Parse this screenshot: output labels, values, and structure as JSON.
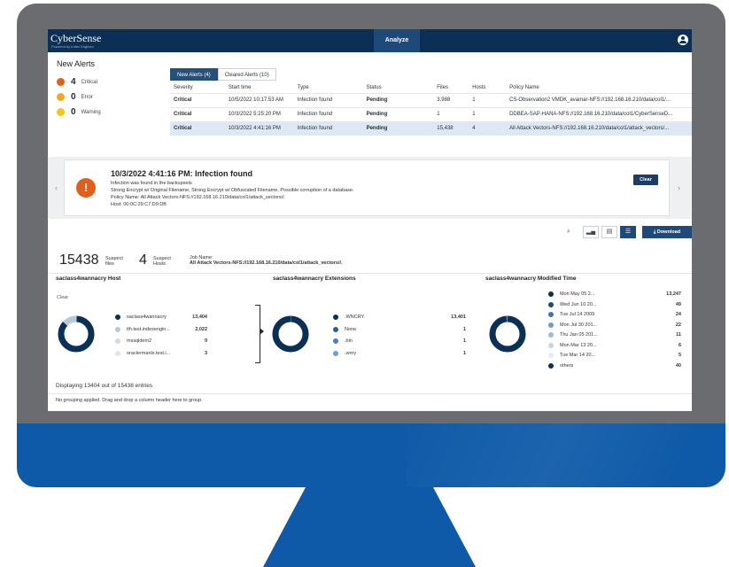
{
  "app": {
    "brand": "CyberSense",
    "brand_sub": "Powered by Index Engines",
    "nav_tab": "Analyze"
  },
  "new_alerts": {
    "title": "New Alerts",
    "items": [
      {
        "count": "4",
        "label": "Critical",
        "color": "#e05f1c"
      },
      {
        "count": "0",
        "label": "Error",
        "color": "#f0a824"
      },
      {
        "count": "0",
        "label": "Warning",
        "color": "#f5c518"
      }
    ]
  },
  "tabs": [
    {
      "label": "New Alerts (4)",
      "active": true
    },
    {
      "label": "Cleared Alerts (10)",
      "active": false
    }
  ],
  "alert_table": {
    "columns": [
      "Severity",
      "Start time",
      "Type",
      "Status",
      "Files",
      "Hosts",
      "Policy Name"
    ],
    "rows": [
      [
        "Critical",
        "10/5/2022 10:17:53 AM",
        "Infection found",
        "Pending",
        "3,988",
        "1",
        "CS-Observation2 VMDK_avamar-NFS://192.168.16.210/data/col1/..."
      ],
      [
        "Critical",
        "10/3/2022 5:25:20 PM",
        "Infection found",
        "Pending",
        "1",
        "1",
        "DDBEA-SAP-HANA-NFS://192.168.16.210/data/col1/CyberSenseD..."
      ],
      [
        "Critical",
        "10/3/2022 4:41:16 PM",
        "Infection found",
        "Pending",
        "15,438",
        "4",
        "All Attack Vectors-NFS://192.168.16.210/data/col1/attack_vectors/..."
      ]
    ]
  },
  "detail": {
    "title": "10/3/2022 4:41:16 PM: Infection found",
    "line1": "Infection was found in the backupsets",
    "line2": "Strong Encrypt w/ Original Filename, Strong Encrypt w/ Obfuscated Filename, Possible corruption of a database.",
    "line3": "Policy Name: All Attack Vectors-NFS://192.168.16.210/data/col1/attack_vectors//.",
    "line4": "Host: 00:0C:29:C7:D9:DB",
    "clear_label": "Clear"
  },
  "toolbar": {
    "download_label": "Download"
  },
  "stats": {
    "files_count": "15438",
    "files_label_1": "Suspect",
    "files_label_2": "files",
    "hosts_count": "4",
    "hosts_label_1": "Suspect",
    "hosts_label_2": "Hosts",
    "job_label": "Job Name:",
    "job_value": "All Attack Vectors-NFS://192.168.16.210/data/col1/attack_vectors//."
  },
  "charts": {
    "host": {
      "title": "saclass4wannacry Host",
      "clear": "Clear",
      "items": [
        {
          "label": "saclass4wannacry",
          "value": "13,404",
          "color": "#0b2f55"
        },
        {
          "label": "tlh.test.indexengin...",
          "value": "2,022",
          "color": "#b8c8da"
        },
        {
          "label": "mssqldem2",
          "value": "9",
          "color": "#cfdae6"
        },
        {
          "label": "oraclermanlx.test.i...",
          "value": "3",
          "color": "#dfe6ee"
        }
      ]
    },
    "ext": {
      "title": "saclass4wannacry Extensions",
      "items": [
        {
          "label": ".WNCRY",
          "value": "13,401",
          "color": "#0b2f55"
        },
        {
          "label": "None",
          "value": "1",
          "color": "#2b5f96"
        },
        {
          "label": ".bin",
          "value": "1",
          "color": "#4f7fb5"
        },
        {
          "label": ".wnry",
          "value": "1",
          "color": "#6aa0d8"
        }
      ]
    },
    "mtime": {
      "title": "saclass4wannacry Modified Time",
      "items": [
        {
          "label": "Mon May 05 2...",
          "value": "13,247",
          "color": "#0b2f55"
        },
        {
          "label": "Wed Jun 10 20...",
          "value": "49",
          "color": "#1d4a78"
        },
        {
          "label": "Tue Jul 14 2009",
          "value": "24",
          "color": "#3f73ad"
        },
        {
          "label": "Mon Jul 30 201...",
          "value": "22",
          "color": "#6f9bcf"
        },
        {
          "label": "Thu Jan 05 201...",
          "value": "11",
          "color": "#9dbbe0"
        },
        {
          "label": "Mon Mar 13 20...",
          "value": "6",
          "color": "#c3d5ea"
        },
        {
          "label": "Tue Mar 14 20...",
          "value": "5",
          "color": "#e3ebf4"
        },
        {
          "label": "others",
          "value": "40",
          "color": "#0b2f55"
        }
      ]
    }
  },
  "footer": {
    "entries": "Displaying 13404 out of 15438 entries",
    "grouping": "No grouping applied. Drag and drop a column header here to group."
  }
}
